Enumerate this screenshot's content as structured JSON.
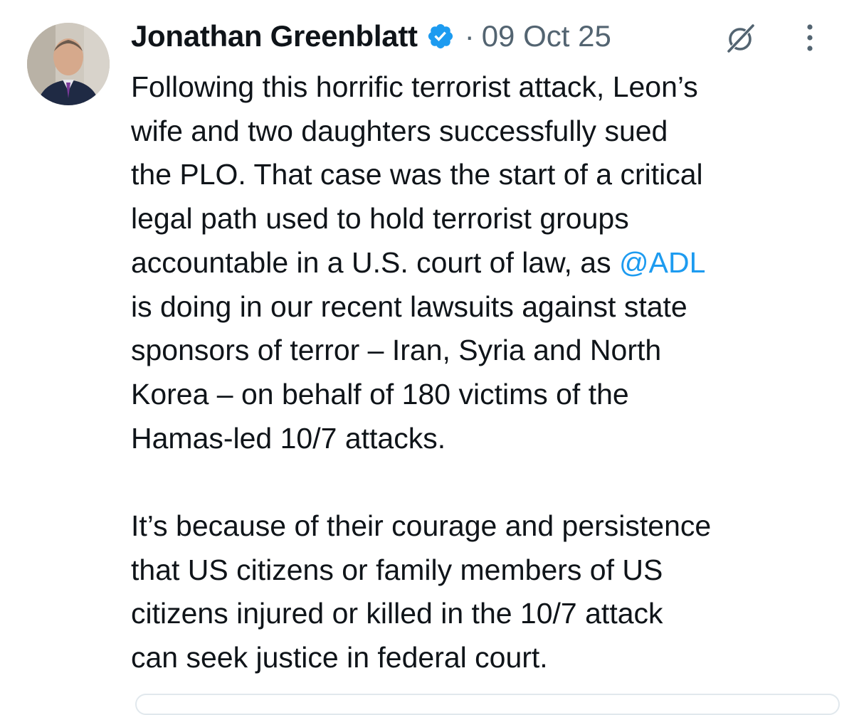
{
  "tweet": {
    "author": {
      "name": "Jonathan Greenblatt",
      "verified": true,
      "avatar_icon": "avatar-photo"
    },
    "separator": "·",
    "timestamp": "09 Oct 25",
    "paragraph1": {
      "before_mention": "Following this horrific terrorist attack, Leon’s\nwife and two daughters successfully sued\nthe PLO. That case was the start of a critical\nlegal path used to hold terrorist groups\naccountable in a U.S. court of law, as ",
      "mention": "@ADL",
      "after_mention": "\nis doing in our recent lawsuits against state\nsponsors of terror – Iran, Syria and North\nKorea – on behalf of 180 victims of the\nHamas-led 10/7 attacks."
    },
    "paragraph2": "It’s because of their courage and persistence\nthat US citizens or family members of US\ncitizens injured or killed in the 10/7 attack\ncan seek justice in federal court."
  },
  "icons": {
    "verified": "verified-badge-icon",
    "grok": "grok-icon",
    "more": "more-options-icon"
  },
  "colors": {
    "text_primary": "#0f1419",
    "text_secondary": "#536471",
    "link": "#1d9bf0",
    "verified_badge": "#1d9bf0"
  }
}
